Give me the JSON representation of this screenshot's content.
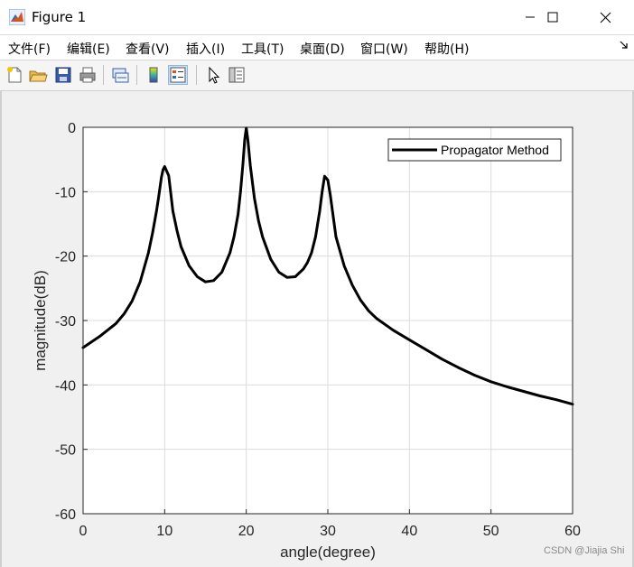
{
  "window": {
    "title": "Figure 1",
    "controls": [
      "minimize",
      "maximize",
      "close"
    ]
  },
  "menu": {
    "items": [
      {
        "label": "文件(F)"
      },
      {
        "label": "编辑(E)"
      },
      {
        "label": "查看(V)"
      },
      {
        "label": "插入(I)"
      },
      {
        "label": "工具(T)"
      },
      {
        "label": "桌面(D)"
      },
      {
        "label": "窗口(W)"
      },
      {
        "label": "帮助(H)"
      }
    ]
  },
  "toolbar": {
    "icons": [
      "new-figure-icon",
      "open-file-icon",
      "save-icon",
      "print-icon",
      "link-plot-icon",
      "insert-colorbar-icon",
      "insert-legend-icon",
      "edit-plot-cursor-icon",
      "property-inspector-icon"
    ],
    "active": "insert-legend-icon"
  },
  "colors": {
    "line": "#000000",
    "grid": "#dcdcdc",
    "axes_bg": "#ffffff",
    "figure_bg": "#f0f0f0"
  },
  "chart_data": {
    "type": "line",
    "xlabel": "angle(degree)",
    "ylabel": "magnitude(dB)",
    "xlim": [
      0,
      60
    ],
    "ylim": [
      -60,
      0
    ],
    "xticks": [
      "0",
      "10",
      "20",
      "30",
      "40",
      "50",
      "60"
    ],
    "yticks": [
      "0",
      "-10",
      "-20",
      "-30",
      "-40",
      "-50",
      "-60"
    ],
    "grid": true,
    "legend_position": "top-right",
    "series": [
      {
        "name": "Propagator Method",
        "x": [
          0,
          2,
          4,
          5,
          6,
          7,
          8,
          8.5,
          9,
          9.3,
          9.6,
          9.8,
          10,
          10.5,
          11,
          11.5,
          12,
          13,
          14,
          15,
          16,
          17,
          18,
          18.5,
          19,
          19.3,
          19.6,
          19.8,
          20,
          20.2,
          20.5,
          21,
          21.5,
          22,
          23,
          24,
          25,
          26,
          27,
          27.5,
          28,
          28.5,
          29,
          29.3,
          29.6,
          30,
          30.3,
          31,
          32,
          33,
          34,
          35,
          36,
          38,
          40,
          42,
          44,
          46,
          48,
          50,
          52,
          54,
          56,
          58,
          60
        ],
        "y": [
          -34.2,
          -32.5,
          -30.5,
          -29.0,
          -27.0,
          -24.0,
          -19.5,
          -16.5,
          -13.0,
          -10.5,
          -7.8,
          -6.6,
          -6.1,
          -7.5,
          -13.0,
          -16.0,
          -18.5,
          -21.5,
          -23.2,
          -24.0,
          -23.8,
          -22.5,
          -19.5,
          -17.0,
          -13.5,
          -10.0,
          -5.5,
          -2.0,
          -0.1,
          -2.0,
          -6.0,
          -11.0,
          -14.5,
          -17.0,
          -20.5,
          -22.5,
          -23.3,
          -23.2,
          -22.0,
          -21.0,
          -19.5,
          -17.0,
          -13.0,
          -10.0,
          -7.6,
          -8.2,
          -10.5,
          -17.0,
          -21.5,
          -24.5,
          -26.8,
          -28.5,
          -29.7,
          -31.5,
          -33.0,
          -34.5,
          -36.0,
          -37.3,
          -38.5,
          -39.5,
          -40.3,
          -41.0,
          -41.7,
          -42.3,
          -43.0
        ]
      }
    ]
  },
  "watermark": "CSDN @Jiajia Shi"
}
